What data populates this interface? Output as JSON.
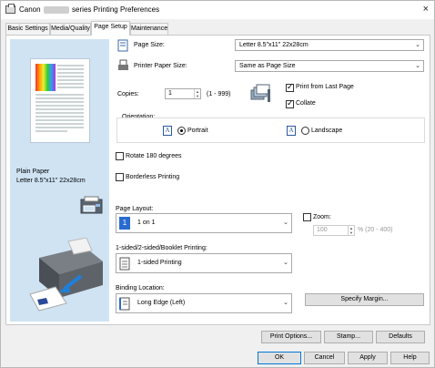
{
  "window": {
    "title_prefix": "Canon",
    "title_suffix": "series Printing Preferences",
    "close": "×"
  },
  "tabs": [
    "Basic Settings",
    "Media/Quality",
    "Page Setup",
    "Maintenance"
  ],
  "active_tab": "Page Setup",
  "preview": {
    "media_line1": "Plain Paper",
    "media_line2": "Letter 8.5\"x11\" 22x28cm"
  },
  "page_size": {
    "label": "Page Size:",
    "value": "Letter 8.5\"x11\" 22x28cm"
  },
  "printer_paper_size": {
    "label": "Printer Paper Size:",
    "value": "Same as Page Size"
  },
  "copies": {
    "label": "Copies:",
    "value": "1",
    "range": "(1 - 999)"
  },
  "print_from_last_page": {
    "label": "Print from Last Page",
    "checked": true
  },
  "collate": {
    "label": "Collate",
    "checked": true
  },
  "orientation": {
    "label": "Orientation:",
    "portrait": "Portrait",
    "landscape": "Landscape",
    "selected": "Portrait"
  },
  "rotate_180": {
    "label": "Rotate 180 degrees",
    "checked": false
  },
  "borderless": {
    "label": "Borderless Printing",
    "checked": false
  },
  "page_layout": {
    "label": "Page Layout:",
    "value": "1 on 1",
    "icon_text": "1"
  },
  "zoom": {
    "label": "Zoom:",
    "checked": false,
    "value": "100",
    "range": "% (20 - 400)"
  },
  "sided": {
    "label": "1-sided/2-sided/Booklet Printing:",
    "value": "1-sided Printing"
  },
  "binding": {
    "label": "Binding Location:",
    "value": "Long Edge (Left)"
  },
  "buttons": {
    "specify_margin": "Specify Margin...",
    "print_options": "Print Options...",
    "stamp": "Stamp...",
    "defaults": "Defaults",
    "ok": "OK",
    "cancel": "Cancel",
    "apply": "Apply",
    "help": "Help"
  }
}
